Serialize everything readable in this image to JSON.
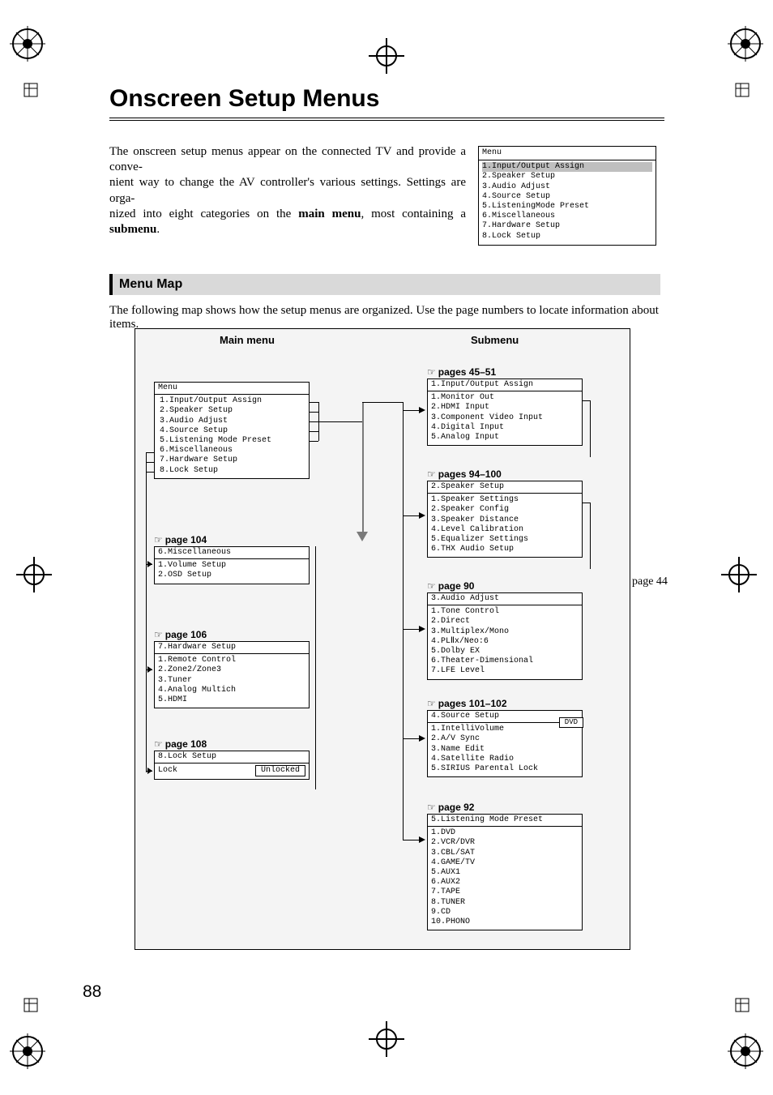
{
  "title": "Onscreen Setup Menus",
  "intro": {
    "line1": "The onscreen setup menus appear on the connected TV and provide a conve-",
    "line2": "nient way to change the AV controller's various settings. Settings are orga-",
    "line3_a": "nized into eight categories on the ",
    "line3_bold1": "main menu",
    "line3_b": ", most containing a ",
    "line3_bold2": "submenu",
    "line3_c": "."
  },
  "preview": {
    "title": "Menu",
    "items": [
      "1.Input/Output Assign",
      "2.Speaker Setup",
      "3.Audio Adjust",
      "4.Source Setup",
      "5.ListeningMode Preset",
      "6.Miscellaneous",
      "7.Hardware Setup",
      "8.Lock Setup"
    ]
  },
  "section": {
    "title": "Menu Map",
    "caption": "The following map shows how the setup menus are organized. Use the page numbers to locate information about items."
  },
  "map": {
    "col_left": "Main menu",
    "col_right": "Submenu",
    "side_page": "page 44"
  },
  "prefs": {
    "p104": "page 104",
    "p106": "page 106",
    "p108": "page 108",
    "p45_51": "pages 45–51",
    "p94_100": "pages 94–100",
    "p90": "page 90",
    "p101_102": "pages 101–102",
    "p92": "page 92"
  },
  "boxes": {
    "main_menu": {
      "title": "Menu",
      "items": [
        "1.Input/Output Assign",
        "2.Speaker Setup",
        "3.Audio Adjust",
        "4.Source Setup",
        "5.Listening Mode Preset",
        "6.Miscellaneous",
        "7.Hardware Setup",
        "8.Lock Setup"
      ]
    },
    "misc": {
      "title": "6.Miscellaneous",
      "items": [
        "1.Volume Setup",
        "2.OSD Setup"
      ]
    },
    "hw": {
      "title": "7.Hardware Setup",
      "items": [
        "1.Remote Control",
        "2.Zone2/Zone3",
        "3.Tuner",
        "4.Analog Multich",
        "5.HDMI"
      ]
    },
    "lock": {
      "title": "8.Lock Setup",
      "row_label": "Lock",
      "row_value": "Unlocked"
    },
    "io": {
      "title": "1.Input/Output Assign",
      "items": [
        "1.Monitor Out",
        "2.HDMI Input",
        "3.Component Video Input",
        "4.Digital Input",
        "5.Analog Input"
      ]
    },
    "speaker": {
      "title": "2.Speaker Setup",
      "items": [
        "1.Speaker Settings",
        "2.Speaker Config",
        "3.Speaker Distance",
        "4.Level Calibration",
        "5.Equalizer Settings",
        "6.THX Audio Setup"
      ]
    },
    "audio": {
      "title": "3.Audio Adjust",
      "items": [
        "1.Tone Control",
        "2.Direct",
        "3.Multiplex/Mono",
        "4.PLⅡx/Neo:6",
        "5.Dolby EX",
        "6.Theater-Dimensional",
        "7.LFE Level"
      ]
    },
    "source": {
      "title": "4.Source Setup",
      "tag": "DVD",
      "items": [
        "1.IntelliVolume",
        "2.A/V Sync",
        "3.Name Edit",
        "4.Satellite Radio",
        "5.SIRIUS Parental Lock"
      ]
    },
    "lmp": {
      "title": "5.Listening Mode Preset",
      "items": [
        "1.DVD",
        "2.VCR/DVR",
        "3.CBL/SAT",
        "4.GAME/TV",
        "5.AUX1",
        "6.AUX2",
        "7.TAPE",
        "8.TUNER",
        "9.CD",
        "10.PHONO"
      ]
    }
  },
  "page_number": "88"
}
